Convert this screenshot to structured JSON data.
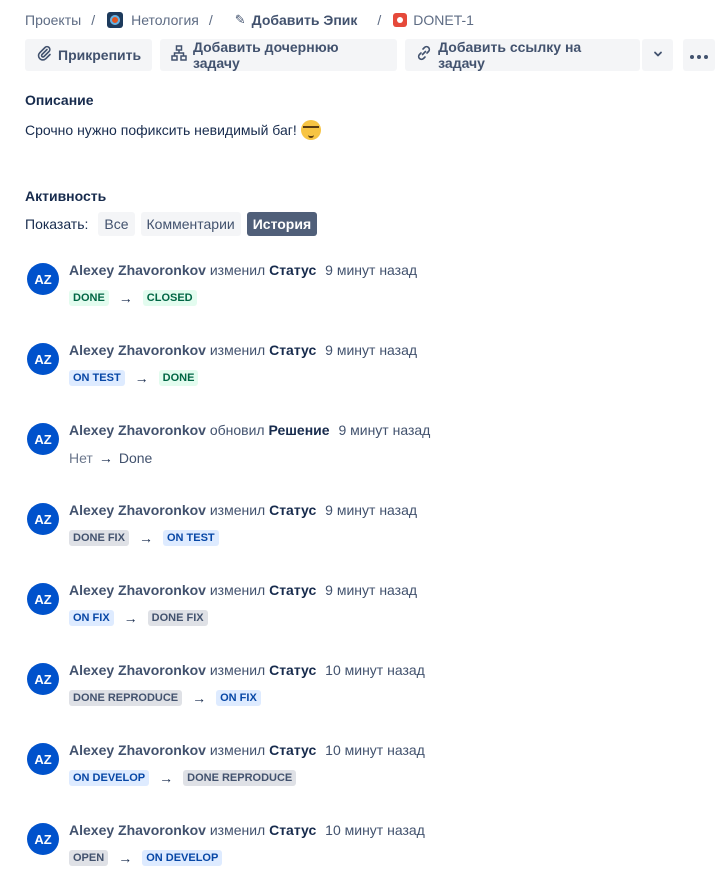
{
  "breadcrumbs": {
    "projects": "Проекты",
    "project": "Нетология",
    "epic": "Добавить Эпик",
    "issue": "DONET-1",
    "separator": "/"
  },
  "toolbar": {
    "attach": "Прикрепить",
    "add_child": "Добавить дочернюю задачу",
    "add_link": "Добавить ссылку на задачу"
  },
  "description": {
    "title": "Описание",
    "text": "Срочно нужно пофиксить невидимый баг!"
  },
  "activity": {
    "title": "Активность",
    "show_label": "Показать:",
    "filters": [
      "Все",
      "Комментарии",
      "История"
    ],
    "active_filter": "История",
    "entries": [
      {
        "initials": "AZ",
        "author": "Alexey Zhavoronkov",
        "action": "изменил",
        "field": "Статус",
        "time": "9 минут назад",
        "from": "DONE",
        "to": "CLOSED"
      },
      {
        "initials": "AZ",
        "author": "Alexey Zhavoronkov",
        "action": "изменил",
        "field": "Статус",
        "time": "9 минут назад",
        "from": "ON TEST",
        "to": "DONE"
      },
      {
        "initials": "AZ",
        "author": "Alexey Zhavoronkov",
        "action": "обновил",
        "field": "Решение",
        "time": "9 минут назад",
        "from": "Нет",
        "to": "Done"
      },
      {
        "initials": "AZ",
        "author": "Alexey Zhavoronkov",
        "action": "изменил",
        "field": "Статус",
        "time": "9 минут назад",
        "from": "DONE FIX",
        "to": "ON TEST"
      },
      {
        "initials": "AZ",
        "author": "Alexey Zhavoronkov",
        "action": "изменил",
        "field": "Статус",
        "time": "9 минут назад",
        "from": "ON FIX",
        "to": "DONE FIX"
      },
      {
        "initials": "AZ",
        "author": "Alexey Zhavoronkov",
        "action": "изменил",
        "field": "Статус",
        "time": "10 минут назад",
        "from": "DONE REPRODUCE",
        "to": "ON FIX"
      },
      {
        "initials": "AZ",
        "author": "Alexey Zhavoronkov",
        "action": "изменил",
        "field": "Статус",
        "time": "10 минут назад",
        "from": "ON DEVELOP",
        "to": "DONE REPRODUCE"
      },
      {
        "initials": "AZ",
        "author": "Alexey Zhavoronkov",
        "action": "изменил",
        "field": "Статус",
        "time": "10 минут назад",
        "from": "OPEN",
        "to": "ON DEVELOP"
      }
    ],
    "arrow": "→"
  },
  "colors": {
    "avatar": "#0052cc",
    "lozenge_green_bg": "#e3fcef",
    "lozenge_green_text": "#006644",
    "lozenge_blue_bg": "#deebff",
    "lozenge_blue_text": "#0747a6",
    "lozenge_grey_bg": "#dfe1e6",
    "lozenge_grey_text": "#42526e",
    "active_filter_bg": "#505f79"
  },
  "icons": {
    "attach": "paperclip-icon",
    "add_child": "hierarchy-icon",
    "add_link": "link-icon",
    "dropdown": "chevron-down-icon",
    "more": "more-icon",
    "epic": "pencil-icon",
    "issue": "bug-icon",
    "emoji": "nerd-face-icon"
  }
}
